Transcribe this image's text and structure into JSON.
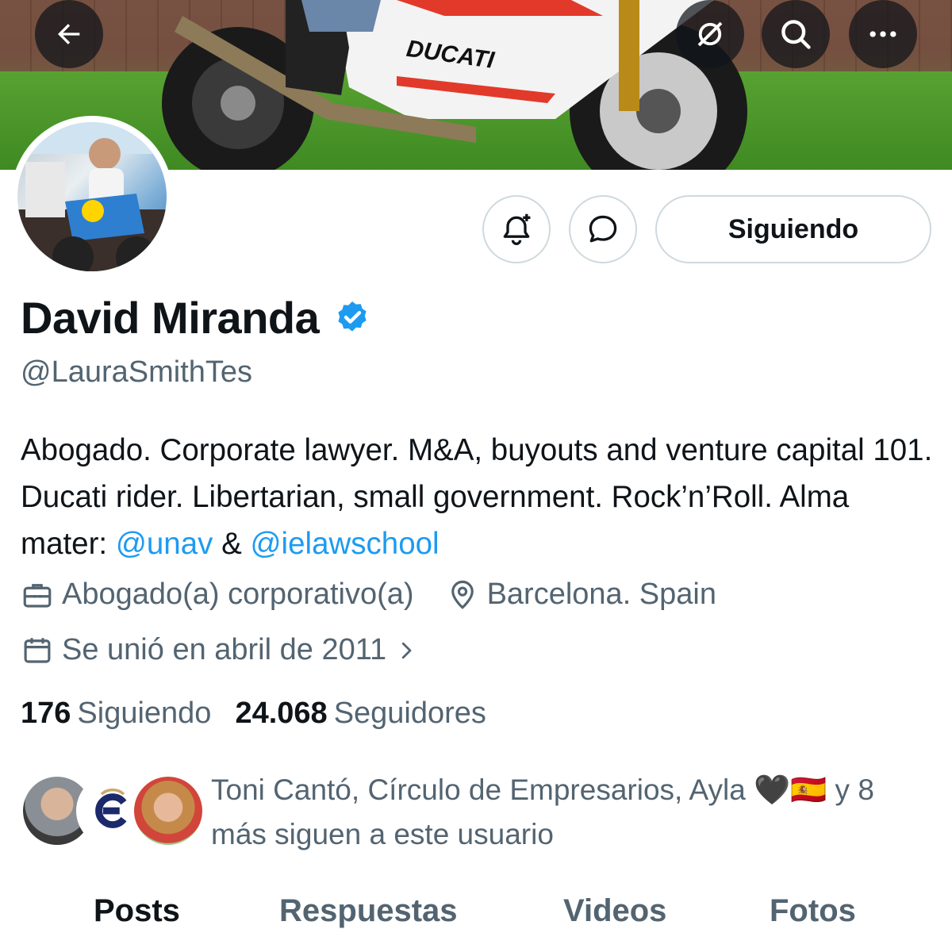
{
  "colors": {
    "accent": "#1d9bf0",
    "text_primary": "#0f1419",
    "text_secondary": "#536471",
    "border": "#cfd9de",
    "verified": "#1d9bf0"
  },
  "banner": {
    "brand_text": "DUCATI"
  },
  "top_bar": {
    "back_icon": "arrow-left-icon",
    "grok_icon": "grok-icon",
    "search_icon": "search-icon",
    "more_icon": "more-icon"
  },
  "actions": {
    "notify_icon": "bell-plus-icon",
    "message_icon": "chat-bubble-icon",
    "follow_label": "Siguiendo"
  },
  "profile": {
    "name": "David Miranda",
    "verified_icon": "verified-badge-icon",
    "handle": "@LauraSmithTes",
    "bio_text": "Abogado. Corporate lawyer. M&A, buyouts and venture capital 101. Ducati rider. Libertarian, small government. Rock’n’Roll. Alma mater: ",
    "bio_mention_1": "@unav",
    "bio_and": " & ",
    "bio_mention_2": "@ielawschool",
    "profession": "Abogado(a) corporativo(a)",
    "location": "Barcelona. Spain",
    "joined": "Se unió en abril de 2011"
  },
  "stats": {
    "following_count": "176",
    "following_label": "Siguiendo",
    "followers_count": "24.068",
    "followers_label": "Seguidores"
  },
  "followed_by": {
    "text": "Toni Cantó, Círculo de Empresarios, Ayla 🖤🇪🇸 y 8 más siguen a este usuario"
  },
  "tabs": [
    {
      "label": "Posts",
      "active": true
    },
    {
      "label": "Respuestas",
      "active": false
    },
    {
      "label": "Videos",
      "active": false
    },
    {
      "label": "Fotos",
      "active": false
    }
  ]
}
